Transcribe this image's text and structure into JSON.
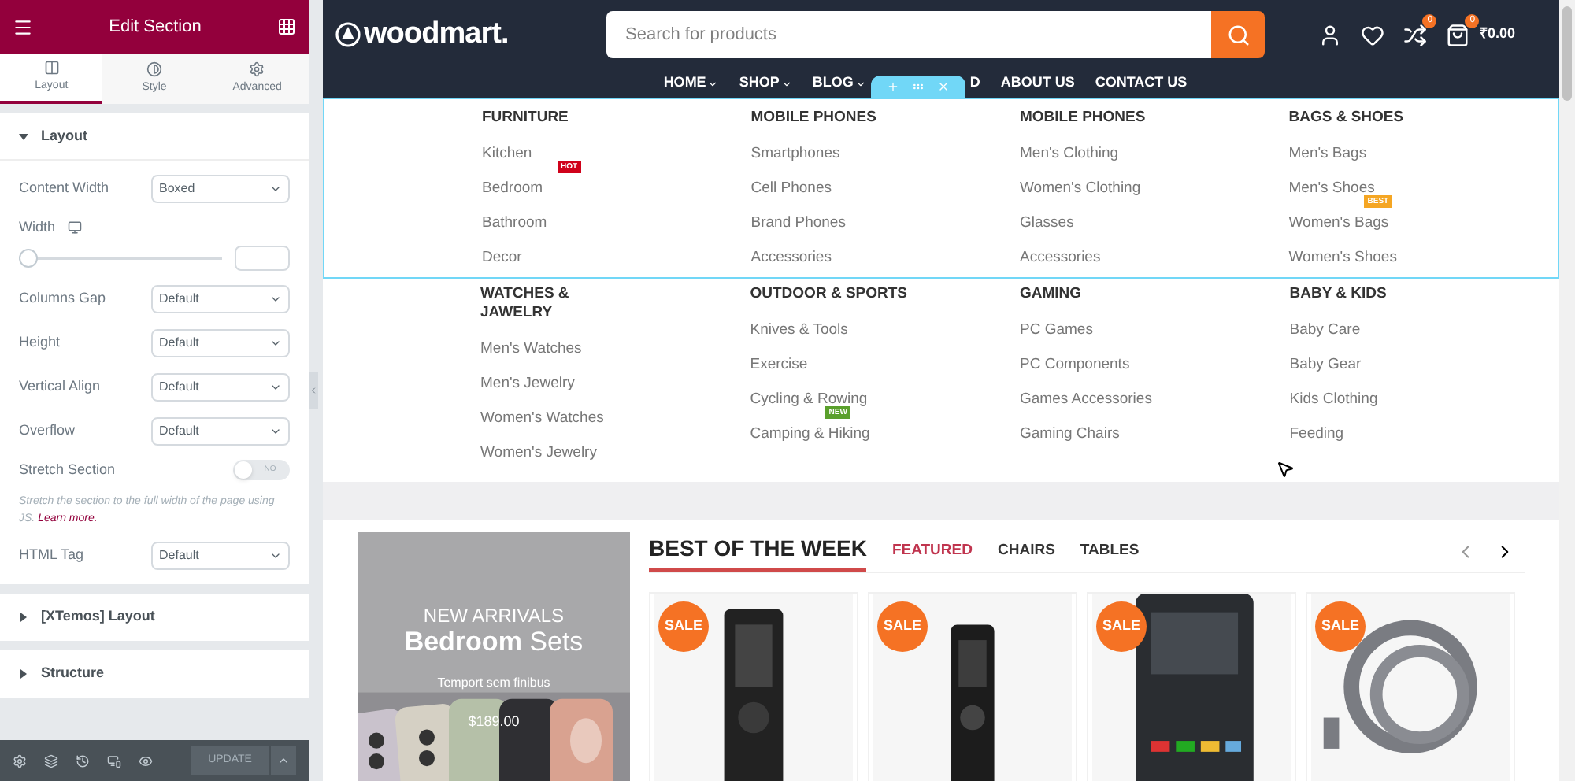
{
  "panel": {
    "title": "Edit Section",
    "tabs": [
      {
        "label": "Layout",
        "selected": true
      },
      {
        "label": "Style",
        "selected": false
      },
      {
        "label": "Advanced",
        "selected": false
      }
    ],
    "sections": [
      {
        "title": "Layout",
        "expanded": true,
        "controls": [
          {
            "kind": "select",
            "label": "Content Width",
            "value": "Boxed"
          },
          {
            "kind": "slider",
            "label": "Width",
            "level": 0
          },
          {
            "kind": "select",
            "label": "Columns Gap",
            "value": "Default"
          },
          {
            "kind": "select",
            "label": "Height",
            "value": "Default"
          },
          {
            "kind": "select",
            "label": "Vertical Align",
            "value": "Default"
          },
          {
            "kind": "select",
            "label": "Overflow",
            "value": "Default"
          },
          {
            "kind": "switch",
            "label": "Stretch Section",
            "on": false,
            "state_text": "NO",
            "hint": "Stretch the section to the full width of the page using JS.",
            "link": "Learn more."
          },
          {
            "kind": "select",
            "label": "HTML Tag",
            "value": "Default"
          }
        ]
      },
      {
        "title": "[XTemos] Layout",
        "expanded": false
      },
      {
        "title": "Structure",
        "expanded": false
      }
    ],
    "update_button": "UPDATE"
  },
  "site": {
    "logo": "woodmart.",
    "search": {
      "placeholder": "Search for products"
    },
    "compare_count": "0",
    "cart_count": "0",
    "cart_total": "₹0.00",
    "nav": [
      {
        "label": "HOME",
        "dropdown": true
      },
      {
        "label": "SHOP",
        "dropdown": true
      },
      {
        "label": "BLOG",
        "dropdown": true
      },
      {
        "label": "D",
        "dropdown": false
      },
      {
        "label": "ABOUT US",
        "dropdown": false
      },
      {
        "label": "CONTACT US",
        "dropdown": false
      }
    ],
    "mega_menu": [
      [
        {
          "title": "FURNITURE",
          "items": [
            {
              "label": "Kitchen"
            },
            {
              "label": "Bedroom",
              "badge": "HOT",
              "color": "#d0021b"
            },
            {
              "label": "Bathroom"
            },
            {
              "label": "Decor"
            }
          ]
        },
        {
          "title": "MOBILE PHONES",
          "items": [
            {
              "label": "Smartphones"
            },
            {
              "label": "Cell Phones"
            },
            {
              "label": "Brand Phones"
            },
            {
              "label": "Accessories"
            }
          ]
        },
        {
          "title": "MOBILE PHONES",
          "items": [
            {
              "label": "Men's Clothing"
            },
            {
              "label": "Women's Clothing"
            },
            {
              "label": "Glasses"
            },
            {
              "label": "Accessories"
            }
          ]
        },
        {
          "title": "BAGS & SHOES",
          "items": [
            {
              "label": "Men's Bags"
            },
            {
              "label": "Men's Shoes"
            },
            {
              "label": "Women's Bags",
              "badge": "BEST",
              "color": "#f5a623"
            },
            {
              "label": "Women's Shoes"
            }
          ]
        }
      ],
      [
        {
          "title": "WATCHES & JAWELRY",
          "items": [
            {
              "label": "Men's Watches"
            },
            {
              "label": "Men's Jewelry"
            },
            {
              "label": "Women's Watches"
            },
            {
              "label": "Women's Jewelry"
            }
          ]
        },
        {
          "title": "OUTDOOR & SPORTS",
          "items": [
            {
              "label": "Knives & Tools"
            },
            {
              "label": "Exercise"
            },
            {
              "label": "Cycling & Rowing"
            },
            {
              "label": "Camping & Hiking",
              "badge": "NEW",
              "color": "#5aa02c"
            }
          ]
        },
        {
          "title": "GAMING",
          "items": [
            {
              "label": "PC Games"
            },
            {
              "label": "PC Components"
            },
            {
              "label": "Games Accessories"
            },
            {
              "label": "Gaming Chairs"
            }
          ]
        },
        {
          "title": "BABY & KIDS",
          "items": [
            {
              "label": "Baby Care"
            },
            {
              "label": "Baby Gear"
            },
            {
              "label": "Kids Clothing"
            },
            {
              "label": "Feeding"
            }
          ]
        }
      ]
    ],
    "banner": {
      "kind": "picture",
      "eyebrow": "NEW ARRIVALS",
      "title": "**Bedroom** Sets",
      "subtitle": "Temport sem finibus",
      "price": "$189.00"
    },
    "section_title": "BEST OF THE WEEK",
    "product_tabs": [
      {
        "label": "FEATURED",
        "selected": true
      },
      {
        "label": "CHAIRS",
        "selected": false
      },
      {
        "label": "TABLES",
        "selected": false
      }
    ],
    "products": [
      {
        "badge": "SALE",
        "kind": "picture"
      },
      {
        "badge": "SALE",
        "kind": "picture"
      },
      {
        "badge": "SALE",
        "kind": "picture"
      },
      {
        "badge": "SALE",
        "kind": "picture"
      }
    ]
  }
}
